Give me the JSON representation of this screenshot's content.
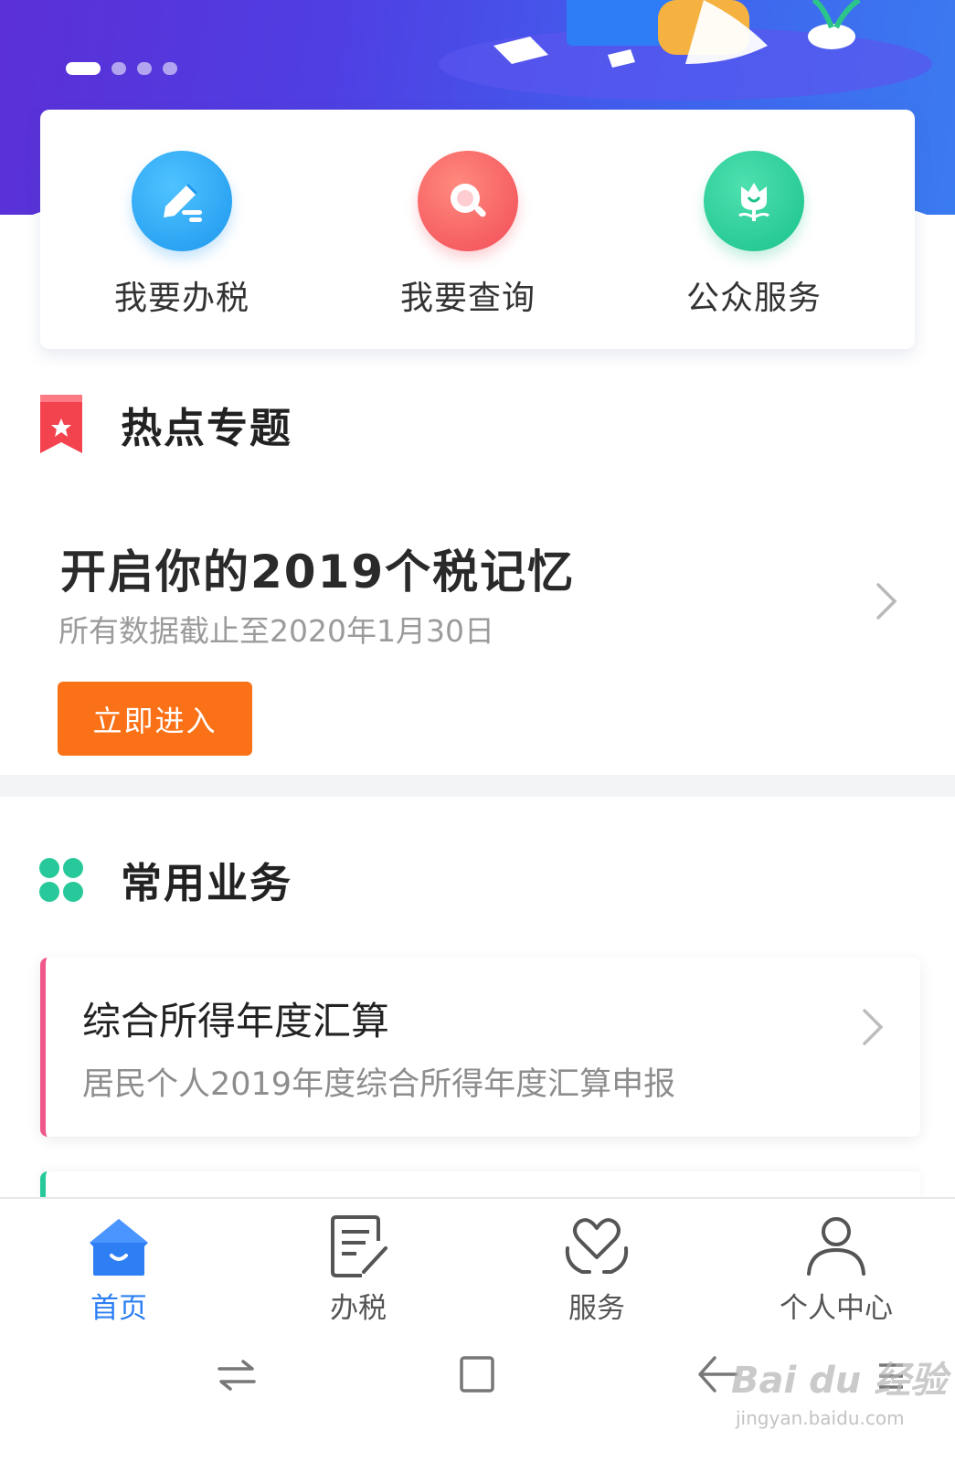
{
  "banner": {
    "slide_count": 4,
    "active_index": 0
  },
  "quick_actions": [
    {
      "label": "我要办税",
      "icon": "pen-edit-icon",
      "color": "#1e97ee"
    },
    {
      "label": "我要查询",
      "icon": "magnifier-icon",
      "color": "#f24c57"
    },
    {
      "label": "公众服务",
      "icon": "tulip-icon",
      "color": "#19c28b"
    }
  ],
  "hot_topics": {
    "section_title": "热点专题",
    "title": "开启你的2019个税记忆",
    "subtitle": "所有数据截止至2020年1月30日",
    "button_label": "立即进入",
    "accent": "#fa7117"
  },
  "common_services": {
    "section_title": "常用业务",
    "items": [
      {
        "title": "综合所得年度汇算",
        "desc": "居民个人2019年度综合所得年度汇算申报",
        "accent": "#f0578a"
      }
    ]
  },
  "tabbar": {
    "active_color": "#2d7ff3",
    "tabs": [
      {
        "label": "首页",
        "icon": "home-icon"
      },
      {
        "label": "办税",
        "icon": "document-edit-icon"
      },
      {
        "label": "服务",
        "icon": "heart-hands-icon"
      },
      {
        "label": "个人中心",
        "icon": "person-icon"
      }
    ]
  },
  "watermark": {
    "brand": "Bai du 经验",
    "url": "jingyan.baidu.com"
  }
}
